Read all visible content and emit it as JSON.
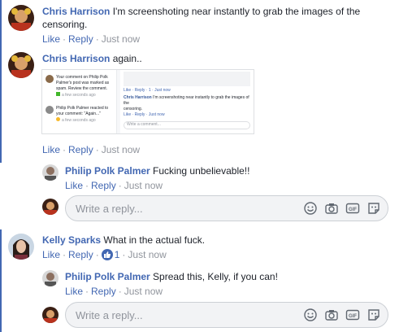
{
  "comments": [
    {
      "author": "Chris Harrison",
      "text": "I'm screenshoting near instantly to grab the images of the censoring.",
      "like": "Like",
      "reply": "Reply",
      "time": "Just now"
    },
    {
      "author": "Chris Harrison",
      "text": "again..",
      "like": "Like",
      "reply": "Reply",
      "time": "Just now",
      "screenshot": {
        "notif1_line1": "Your comment on Philip Polk",
        "notif1_line2": "Palmer's post was marked as",
        "notif1_line3": "spam. Review the comment.",
        "notif1_time": "a few seconds ago",
        "notif2_line1": "Philip Polk Palmer reacted to",
        "notif2_line2": "your comment: \"Again...\"",
        "notif2_time": "a few seconds ago",
        "inner_actions": "Like · Reply · 1 · Just now",
        "inner_author": "Chris Harrison",
        "inner_text": "I'm screenshoting near instantly to grab the images of the",
        "inner_text2": "censoring.",
        "inner_actions2": "Like · Reply · Just now",
        "inner_placeholder": "Write a comment..."
      }
    },
    {
      "author": "Philip Polk Palmer",
      "text": "Fucking unbelievable!!",
      "like": "Like",
      "reply": "Reply",
      "time": "Just now"
    },
    {
      "author": "Kelly Sparks",
      "text": "What in the actual fuck.",
      "like": "Like",
      "reply": "Reply",
      "reaction_count": "1",
      "time": "Just now"
    },
    {
      "author": "Philip Polk Palmer",
      "text": "Spread this, Kelly, if you can!",
      "like": "Like",
      "reply": "Reply",
      "time": "Just now"
    }
  ],
  "reply_placeholder": "Write a reply...",
  "icons": [
    "emoji-icon",
    "camera-icon",
    "gif-icon",
    "sticker-icon"
  ],
  "colors": {
    "name": "#365899",
    "link": "#4267b2",
    "meta": "#90949c",
    "thread": "#4267b2"
  }
}
